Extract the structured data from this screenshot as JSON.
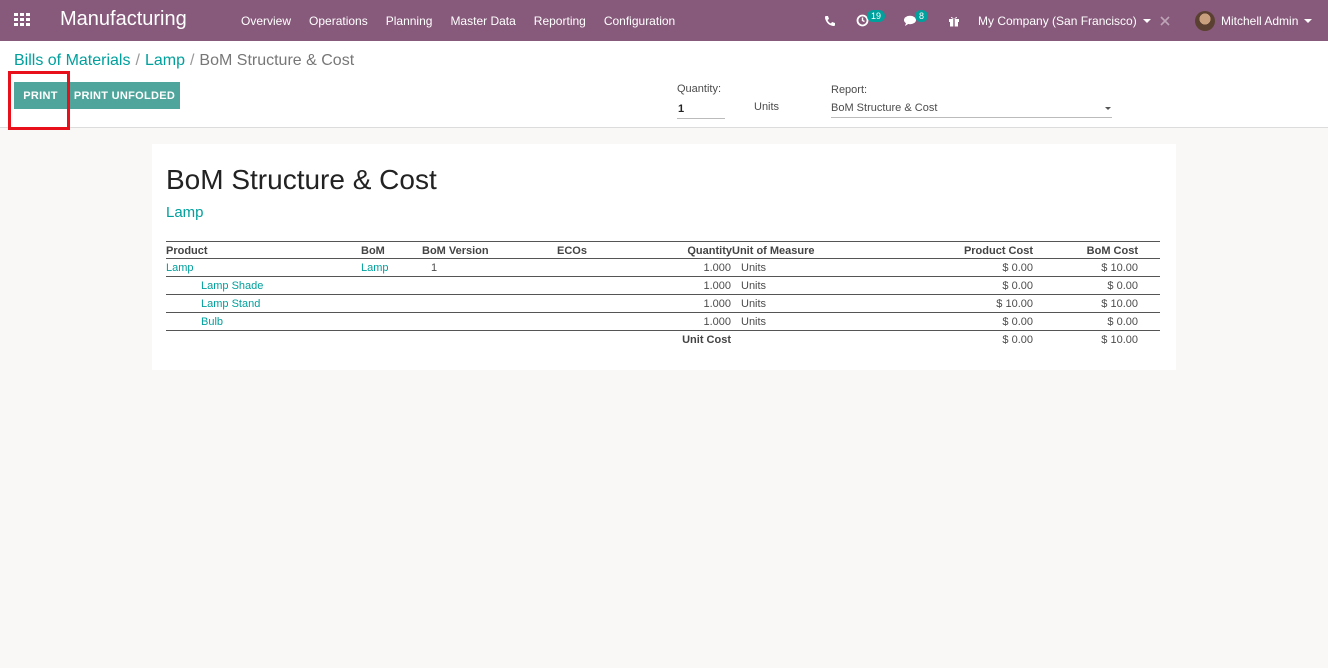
{
  "navbar": {
    "app_title": "Manufacturing",
    "menu": [
      "Overview",
      "Operations",
      "Planning",
      "Master Data",
      "Reporting",
      "Configuration"
    ],
    "activity_count": "19",
    "message_count": "8",
    "company": "My Company (San Francisco)",
    "user": "Mitchell Admin"
  },
  "breadcrumb": {
    "item1": "Bills of Materials",
    "item2": "Lamp",
    "current": "BoM Structure & Cost",
    "separator": "/"
  },
  "toolbar": {
    "print_label": "PRINT",
    "print_unfolded_label": "PRINT UNFOLDED",
    "quantity_label": "Quantity:",
    "quantity_value": "1",
    "units_label": "Units",
    "report_label": "Report:",
    "report_value": "BoM Structure & Cost"
  },
  "report": {
    "title": "BoM Structure & Cost",
    "product": "Lamp",
    "headers": {
      "product": "Product",
      "bom": "BoM",
      "bom_version": "BoM Version",
      "ecos": "ECOs",
      "quantity": "Quantity",
      "uom": "Unit of Measure",
      "product_cost": "Product Cost",
      "bom_cost": "BoM Cost"
    },
    "rows": [
      {
        "product": "Lamp",
        "bom": "Lamp",
        "version": "1",
        "quantity": "1.000",
        "uom": "Units",
        "product_cost": "$ 0.00",
        "bom_cost": "$ 10.00"
      },
      {
        "product": "Lamp Shade",
        "quantity": "1.000",
        "uom": "Units",
        "product_cost": "$ 0.00",
        "bom_cost": "$ 0.00"
      },
      {
        "product": "Lamp Stand",
        "quantity": "1.000",
        "uom": "Units",
        "product_cost": "$ 10.00",
        "bom_cost": "$ 10.00"
      },
      {
        "product": "Bulb",
        "quantity": "1.000",
        "uom": "Units",
        "product_cost": "$ 0.00",
        "bom_cost": "$ 0.00"
      }
    ],
    "total": {
      "label": "Unit Cost",
      "product_cost": "$ 0.00",
      "bom_cost": "$ 10.00"
    }
  },
  "colors": {
    "navbar": "#875a7b",
    "accent": "#00a09d",
    "button": "#4fa59b",
    "highlight": "#e8101a"
  }
}
